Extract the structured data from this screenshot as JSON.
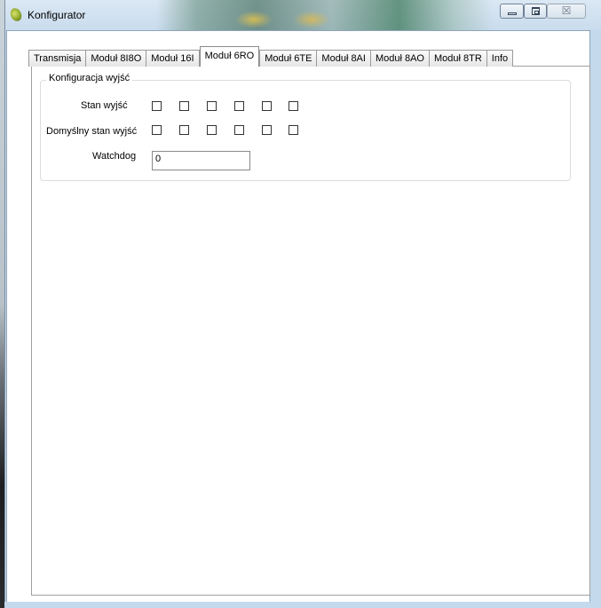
{
  "window": {
    "title": "Konfigurator",
    "accent": "#c5d9ec",
    "controls": {
      "minimize_icon": "minimize-icon",
      "maximize_icon": "maximize-icon",
      "close_icon": "close-icon",
      "close_glyph": "☒"
    }
  },
  "tabs": [
    {
      "label": "Transmisja",
      "active": false
    },
    {
      "label": "Moduł 8I8O",
      "active": false
    },
    {
      "label": "Moduł 16I",
      "active": false
    },
    {
      "label": "Moduł 6RO",
      "active": true
    },
    {
      "label": "Moduł 6TE",
      "active": false
    },
    {
      "label": "Moduł 8AI",
      "active": false
    },
    {
      "label": "Moduł 8AO",
      "active": false
    },
    {
      "label": "Moduł 8TR",
      "active": false
    },
    {
      "label": "Info",
      "active": false
    }
  ],
  "group": {
    "title": "Konfiguracja wyjść",
    "outputs_state_label": "Stan wyjść",
    "outputs_state_checked": [
      false,
      false,
      false,
      false,
      false,
      false
    ],
    "default_state_label": "Domyślny stan wyjść",
    "default_state_checked": [
      false,
      false,
      false,
      false,
      false,
      false
    ],
    "watchdog_label": "Watchdog",
    "watchdog_value": "0"
  }
}
